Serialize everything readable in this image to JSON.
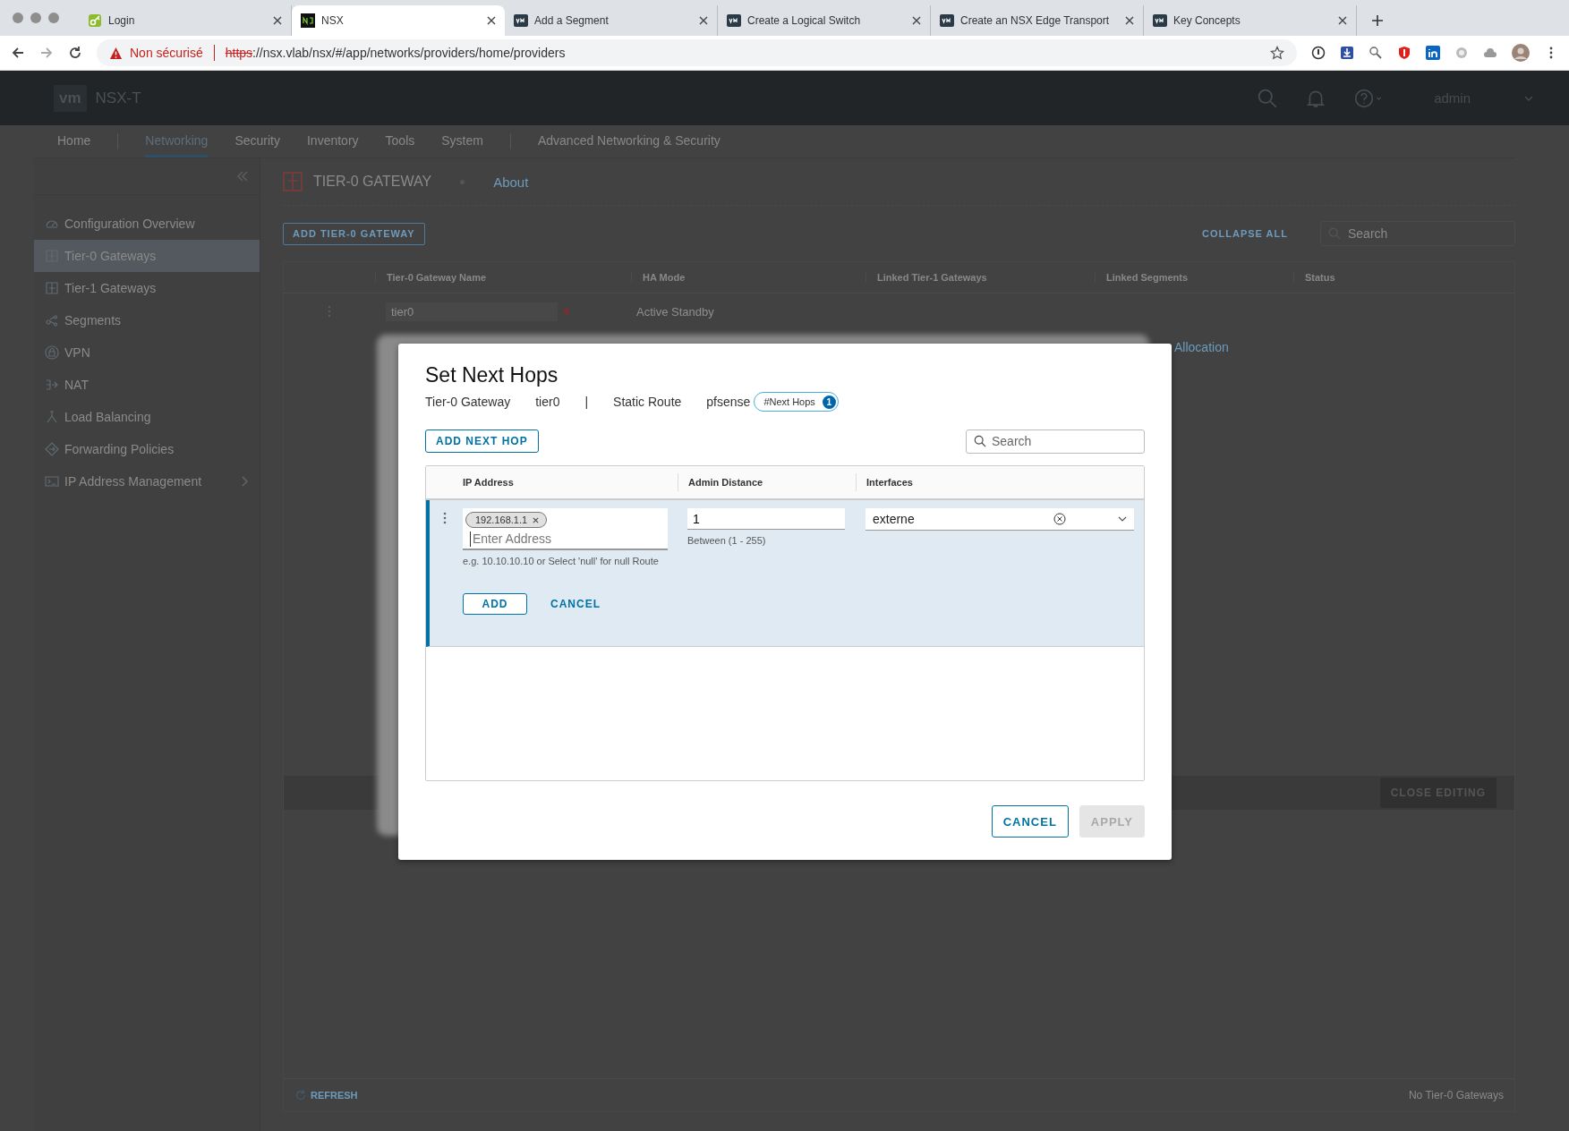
{
  "browser": {
    "tabs": [
      {
        "title": "Login",
        "kind": "login",
        "selected": false
      },
      {
        "title": "NSX",
        "kind": "nsx",
        "selected": true
      },
      {
        "title": "Add a Segment",
        "kind": "vm",
        "selected": false
      },
      {
        "title": "Create a Logical Switch",
        "kind": "vm",
        "selected": false
      },
      {
        "title": "Create an NSX Edge Transport",
        "kind": "vm",
        "selected": false
      },
      {
        "title": "Key Concepts",
        "kind": "vm",
        "selected": false
      }
    ],
    "security_warning": "Non sécurisé",
    "url": {
      "scheme": "https",
      "rest": "://nsx.vlab/nsx/#/app/networks/providers/home/providers"
    }
  },
  "header": {
    "logo": "vm",
    "product": "NSX-T",
    "user": "admin"
  },
  "nav": [
    {
      "label": "Home",
      "selected": false
    },
    {
      "label": "Networking",
      "selected": true
    },
    {
      "label": "Security",
      "selected": false
    },
    {
      "label": "Inventory",
      "selected": false
    },
    {
      "label": "Tools",
      "selected": false
    },
    {
      "label": "System",
      "selected": false
    },
    {
      "label": "Advanced Networking & Security",
      "selected": false
    }
  ],
  "sidebar": [
    {
      "label": "Configuration Overview",
      "selected": false,
      "expandable": false
    },
    {
      "label": "Tier-0 Gateways",
      "selected": true,
      "expandable": false
    },
    {
      "label": "Tier-1 Gateways",
      "selected": false,
      "expandable": false
    },
    {
      "label": "Segments",
      "selected": false,
      "expandable": false
    },
    {
      "label": "VPN",
      "selected": false,
      "expandable": false
    },
    {
      "label": "NAT",
      "selected": false,
      "expandable": false
    },
    {
      "label": "Load Balancing",
      "selected": false,
      "expandable": false
    },
    {
      "label": "Forwarding Policies",
      "selected": false,
      "expandable": false
    },
    {
      "label": "IP Address Management",
      "selected": false,
      "expandable": true
    }
  ],
  "page": {
    "title": "TIER-0 GATEWAY",
    "about": "About",
    "add_button": "ADD TIER-0 GATEWAY",
    "collapse_all": "COLLAPSE ALL",
    "search_placeholder": "Search",
    "columns": [
      "Tier-0 Gateway Name",
      "HA Mode",
      "Linked Tier-1 Gateways",
      "Linked Segments",
      "Status"
    ],
    "row": {
      "name": "tier0",
      "required": true,
      "ha_mode": "Active Standby",
      "link": "Allocation"
    },
    "close_editing": "CLOSE EDITING",
    "refresh": "REFRESH",
    "footer_count": "No Tier-0 Gateways"
  },
  "dialog": {
    "title": "Set Next Hops",
    "context": [
      {
        "label": "Tier-0 Gateway",
        "value": "tier0"
      },
      {
        "label": "Static Route",
        "value": "pfsense"
      }
    ],
    "separator": "|",
    "badge": {
      "label": "#Next Hops",
      "count": "1"
    },
    "add_button": "ADD NEXT HOP",
    "search_placeholder": "Search",
    "columns": [
      "IP Address",
      "Admin Distance",
      "Interfaces"
    ],
    "edit_row": {
      "ip_tags": [
        "192.168.1.1"
      ],
      "ip_placeholder": "Enter Address",
      "ip_hint": "e.g. 10.10.10.10 or Select 'null' for null Route",
      "admin_distance": "1",
      "distance_hint": "Between (1 - 255)",
      "interface": "externe",
      "add": "ADD",
      "cancel": "CANCEL"
    },
    "buttons": [
      {
        "label": "CANCEL",
        "disabled": false
      },
      {
        "label": "APPLY",
        "disabled": true
      }
    ]
  }
}
